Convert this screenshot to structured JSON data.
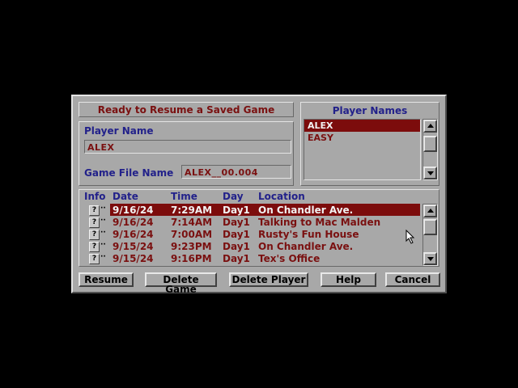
{
  "dialog": {
    "title": "Ready to Resume a Saved Game",
    "player_name_label": "Player Name",
    "player_name_value": "ALEX",
    "game_file_label": "Game File Name",
    "game_file_value": "ALEX__00.004"
  },
  "player_names": {
    "header": "Player Names",
    "items": [
      {
        "label": "ALEX",
        "selected": true
      },
      {
        "label": "EASY",
        "selected": false
      }
    ]
  },
  "saves": {
    "columns": [
      "Info",
      "Date",
      "Time",
      "Day",
      "Location"
    ],
    "rows": [
      {
        "date": "9/16/24",
        "time": "7:29AM",
        "day": "Day1",
        "location": "On Chandler Ave.",
        "selected": true
      },
      {
        "date": "9/16/24",
        "time": "7:14AM",
        "day": "Day1",
        "location": "Talking to Mac Malden",
        "selected": false
      },
      {
        "date": "9/16/24",
        "time": "7:00AM",
        "day": "Day1",
        "location": "Rusty's Fun House",
        "selected": false
      },
      {
        "date": "9/15/24",
        "time": "9:23PM",
        "day": "Day1",
        "location": "On Chandler Ave.",
        "selected": false
      },
      {
        "date": "9/15/24",
        "time": "9:16PM",
        "day": "Day1",
        "location": "Tex's Office",
        "selected": false
      }
    ],
    "info_glyph": "?",
    "info_dots": "··"
  },
  "buttons": {
    "resume": "Resume",
    "delete_game": "Delete Game",
    "delete_player": "Delete Player",
    "help": "Help",
    "cancel": "Cancel"
  },
  "colors": {
    "dialog_bg": "#a8a8a8",
    "selection": "#7c0c0c",
    "label_blue": "#22218a",
    "text_maroon": "#7a1010"
  }
}
